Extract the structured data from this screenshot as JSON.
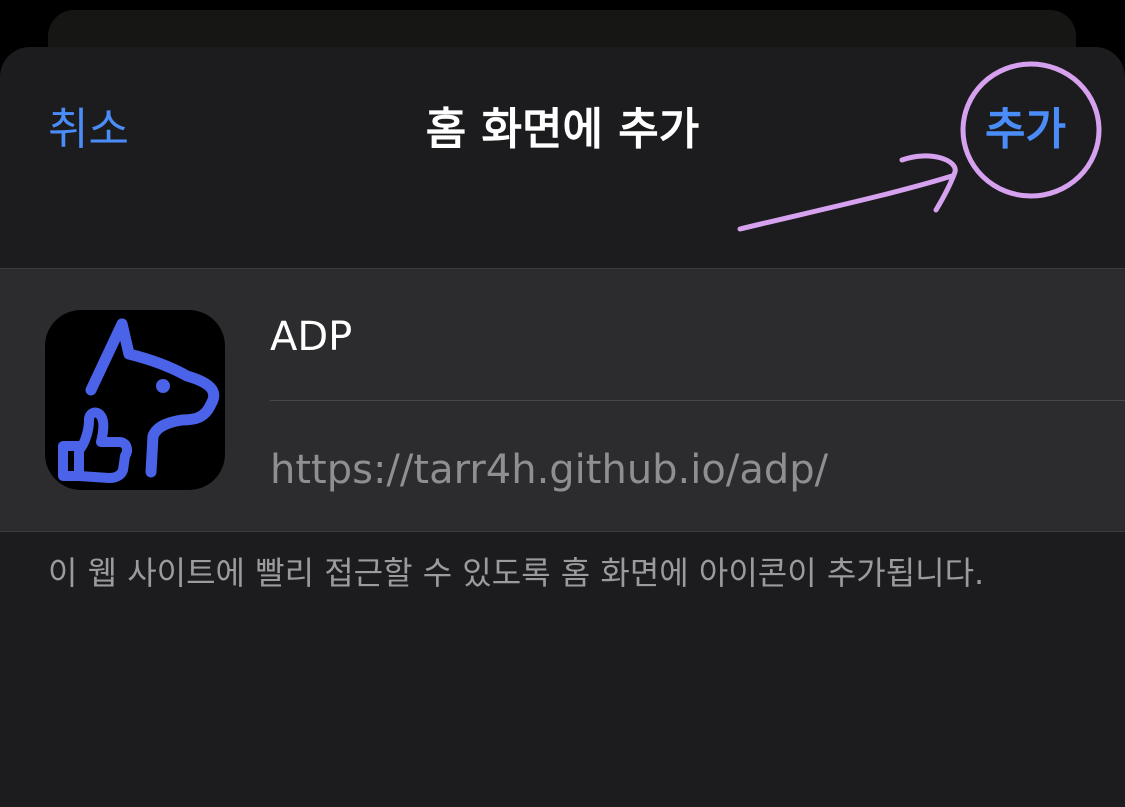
{
  "nav": {
    "cancel_label": "취소",
    "title": "홈 화면에 추가",
    "add_label": "추가"
  },
  "app": {
    "name": "ADP",
    "url": "https://tarr4h.github.io/adp/",
    "icon": "dog-thumbs-up-icon"
  },
  "footer": {
    "text": "이 웹 사이트에 빨리 접근할 수 있도록 홈 화면에 아이콘이 추가됩니다."
  },
  "colors": {
    "accent": "#4b8df8",
    "sheet_background": "#1c1c1e",
    "card_background": "#2c2c2e",
    "annotation": "#d6a2f0",
    "icon_stroke": "#4a63e8"
  }
}
